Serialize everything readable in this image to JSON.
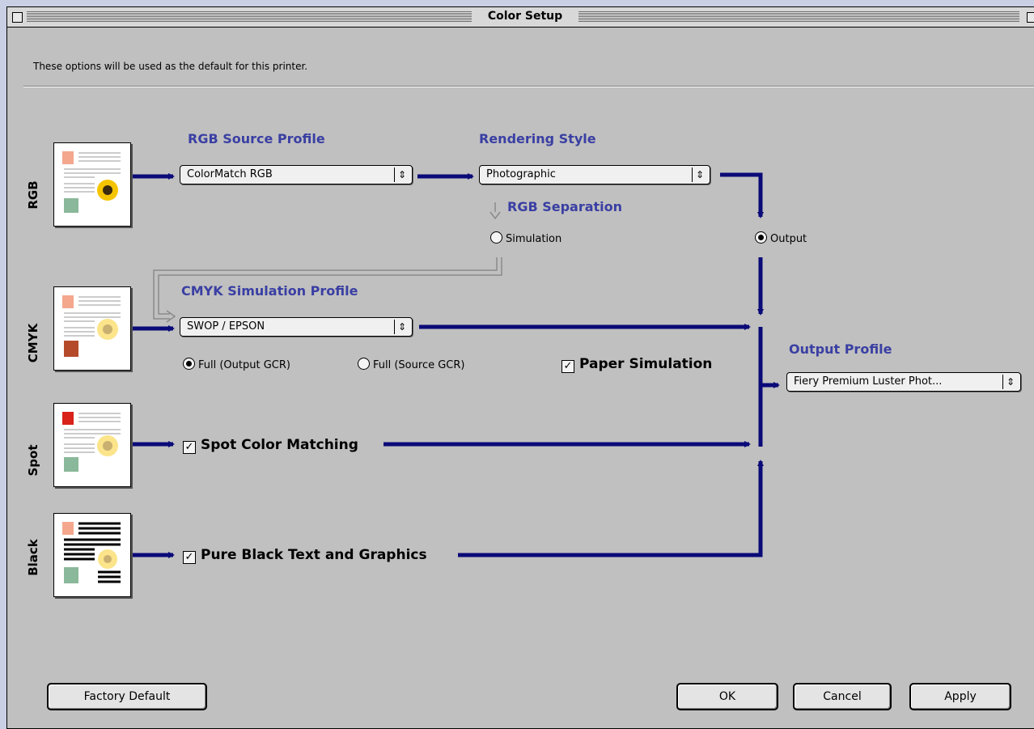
{
  "window": {
    "title": "Color Setup"
  },
  "intro_text": "These options will be used as the default for this printer.",
  "rows": {
    "rgb_label": "RGB",
    "cmyk_label": "CMYK",
    "spot_label": "Spot",
    "black_label": "Black"
  },
  "rgb_source": {
    "heading": "RGB Source Profile",
    "value": "ColorMatch RGB"
  },
  "rendering": {
    "heading": "Rendering Style",
    "value": "Photographic"
  },
  "rgb_separation": {
    "heading": "RGB Separation",
    "simulation_label": "Simulation",
    "output_label": "Output",
    "selected": "Output"
  },
  "cmyk_simulation": {
    "heading": "CMYK Simulation Profile",
    "value": "SWOP / EPSON",
    "gcr_options": [
      "Full (Output GCR)",
      "Full (Source GCR)"
    ],
    "selected_gcr": "Full (Output GCR)"
  },
  "paper_simulation": {
    "label": "Paper Simulation",
    "checked": true
  },
  "spot_matching": {
    "label": "Spot Color Matching",
    "checked": true
  },
  "pure_black": {
    "label": "Pure Black Text and Graphics",
    "checked": true
  },
  "output_profile": {
    "heading": "Output Profile",
    "value": "Fiery Premium Luster Phot..."
  },
  "buttons": {
    "factory_default": "Factory Default",
    "ok": "OK",
    "cancel": "Cancel",
    "apply": "Apply"
  },
  "colors": {
    "flow_line": "#0a0a78",
    "heading": "#3a3fa3",
    "dialog_bg": "#c0c0c0"
  }
}
